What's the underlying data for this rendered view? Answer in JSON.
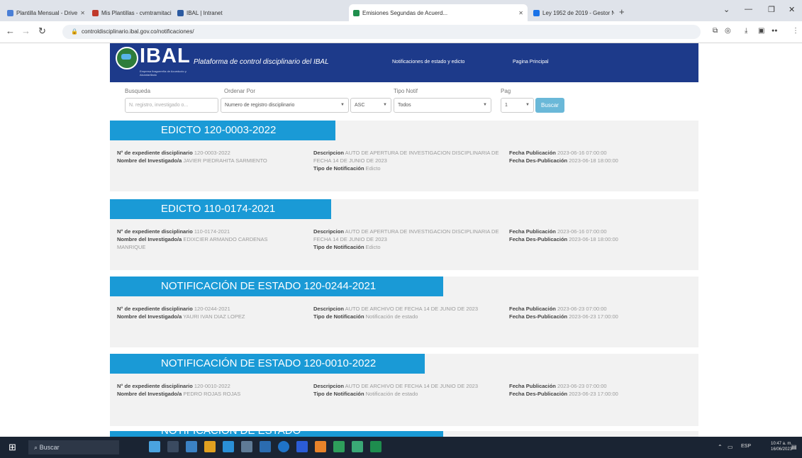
{
  "browser": {
    "tabs": [
      {
        "title": "Plantilla Mensual - Drive",
        "color": "#4a7fd6"
      },
      {
        "title": "Mis Plantillas - cvmtramitación - ..",
        "color": "#c0392b"
      },
      {
        "title": "IBAL | Intranet",
        "color": "#2c5aa0"
      },
      {
        "title": "Emisiones Segundas de Acuerd...",
        "color": "#1f8f4d"
      },
      {
        "title": "Ley 1952 de 2019 - Gestor Norm...",
        "color": "#1a73e8"
      }
    ],
    "url": "controldisciplinario.ibal.gov.co/notificaciones/",
    "window_buttons": [
      "⌄",
      "—",
      "❐",
      "✕"
    ]
  },
  "site": {
    "logo_text": "IBAL",
    "logo_tagline": "Empresa Ibaguereña de Acueducto y Alcantarillado",
    "platform_title": "Plataforma de control disciplinario del IBAL",
    "nav": {
      "notifications": "Notificaciones de estado y edicto",
      "home": "Pagina Principal"
    }
  },
  "form": {
    "search_label": "Busqueda",
    "search_placeholder": "N. registro, investigado o...",
    "order_label": "Ordenar Por",
    "order_value": "Numero de registro disciplinario",
    "direction_value": "ASC",
    "type_label": "Tipo Notif",
    "type_value": "Todos",
    "page_label": "Pag",
    "page_value": "1",
    "search_button": "Buscar"
  },
  "labels": {
    "expediente": "N° de expediente disciplinario",
    "investigado": "Nombre del Investigado/a",
    "descripcion": "Descripcion",
    "tipo": "Tipo de Notificación",
    "publicacion": "Fecha Publicación",
    "despublicacion": "Fecha Des-Publicación"
  },
  "notices": [
    {
      "title": "EDICTO 120-0003-2022",
      "expediente": "120-0003-2022",
      "investigado": "JAVIER PIEDRAHITA SARMIENTO",
      "descripcion": "AUTO DE APERTURA DE INVESTIGACION DISCIPLINARIA DE FECHA 14 DE JUNIO DE 2023",
      "tipo": "Edicto",
      "fecha_publicacion": "2023-06-16 07:00:00",
      "fecha_despublicacion": "2023-06-18 18:00:00"
    },
    {
      "title": "EDICTO 110-0174-2021",
      "expediente": "110-0174-2021",
      "investigado": "EDIXCIER ARMANDO CARDENAS MANRIQUE",
      "descripcion": "AUTO DE APERTURA DE INVESTIGACION DISCIPLINARIA DE FECHA 14 DE JUNIO DE 2023",
      "tipo": "Edicto",
      "fecha_publicacion": "2023-06-16 07:00:00",
      "fecha_despublicacion": "2023-06-18 18:00:00"
    },
    {
      "title": "NOTIFICACIÓN DE ESTADO 120-0244-2021",
      "expediente": "120-0244-2021",
      "investigado": "YAURI IVAN DIAZ LOPEZ",
      "descripcion": "AUTO DE ARCHIVO DE FECHA 14 DE JUNIO DE 2023",
      "tipo": "Notificación de estado",
      "fecha_publicacion": "2023-06-23 07:00:00",
      "fecha_despublicacion": "2023-06-23 17:00:00"
    },
    {
      "title": "NOTIFICACIÓN DE ESTADO 120-0010-2022",
      "expediente": "120-0010-2022",
      "investigado": "PEDRO ROJAS ROJAS",
      "descripcion": "AUTO DE ARCHIVO DE FECHA 14 DE JUNIO DE 2023",
      "tipo": "Notificación de estado",
      "fecha_publicacion": "2023-06-23 07:00:00",
      "fecha_despublicacion": "2023-06-23 17:00:00"
    },
    {
      "title": "NOTIFICACIÓN DE ESTADO"
    }
  ],
  "taskbar": {
    "search_text": "Buscar",
    "time": "10:47 a. m.",
    "date": "16/06/2023",
    "lang": "ESP"
  }
}
